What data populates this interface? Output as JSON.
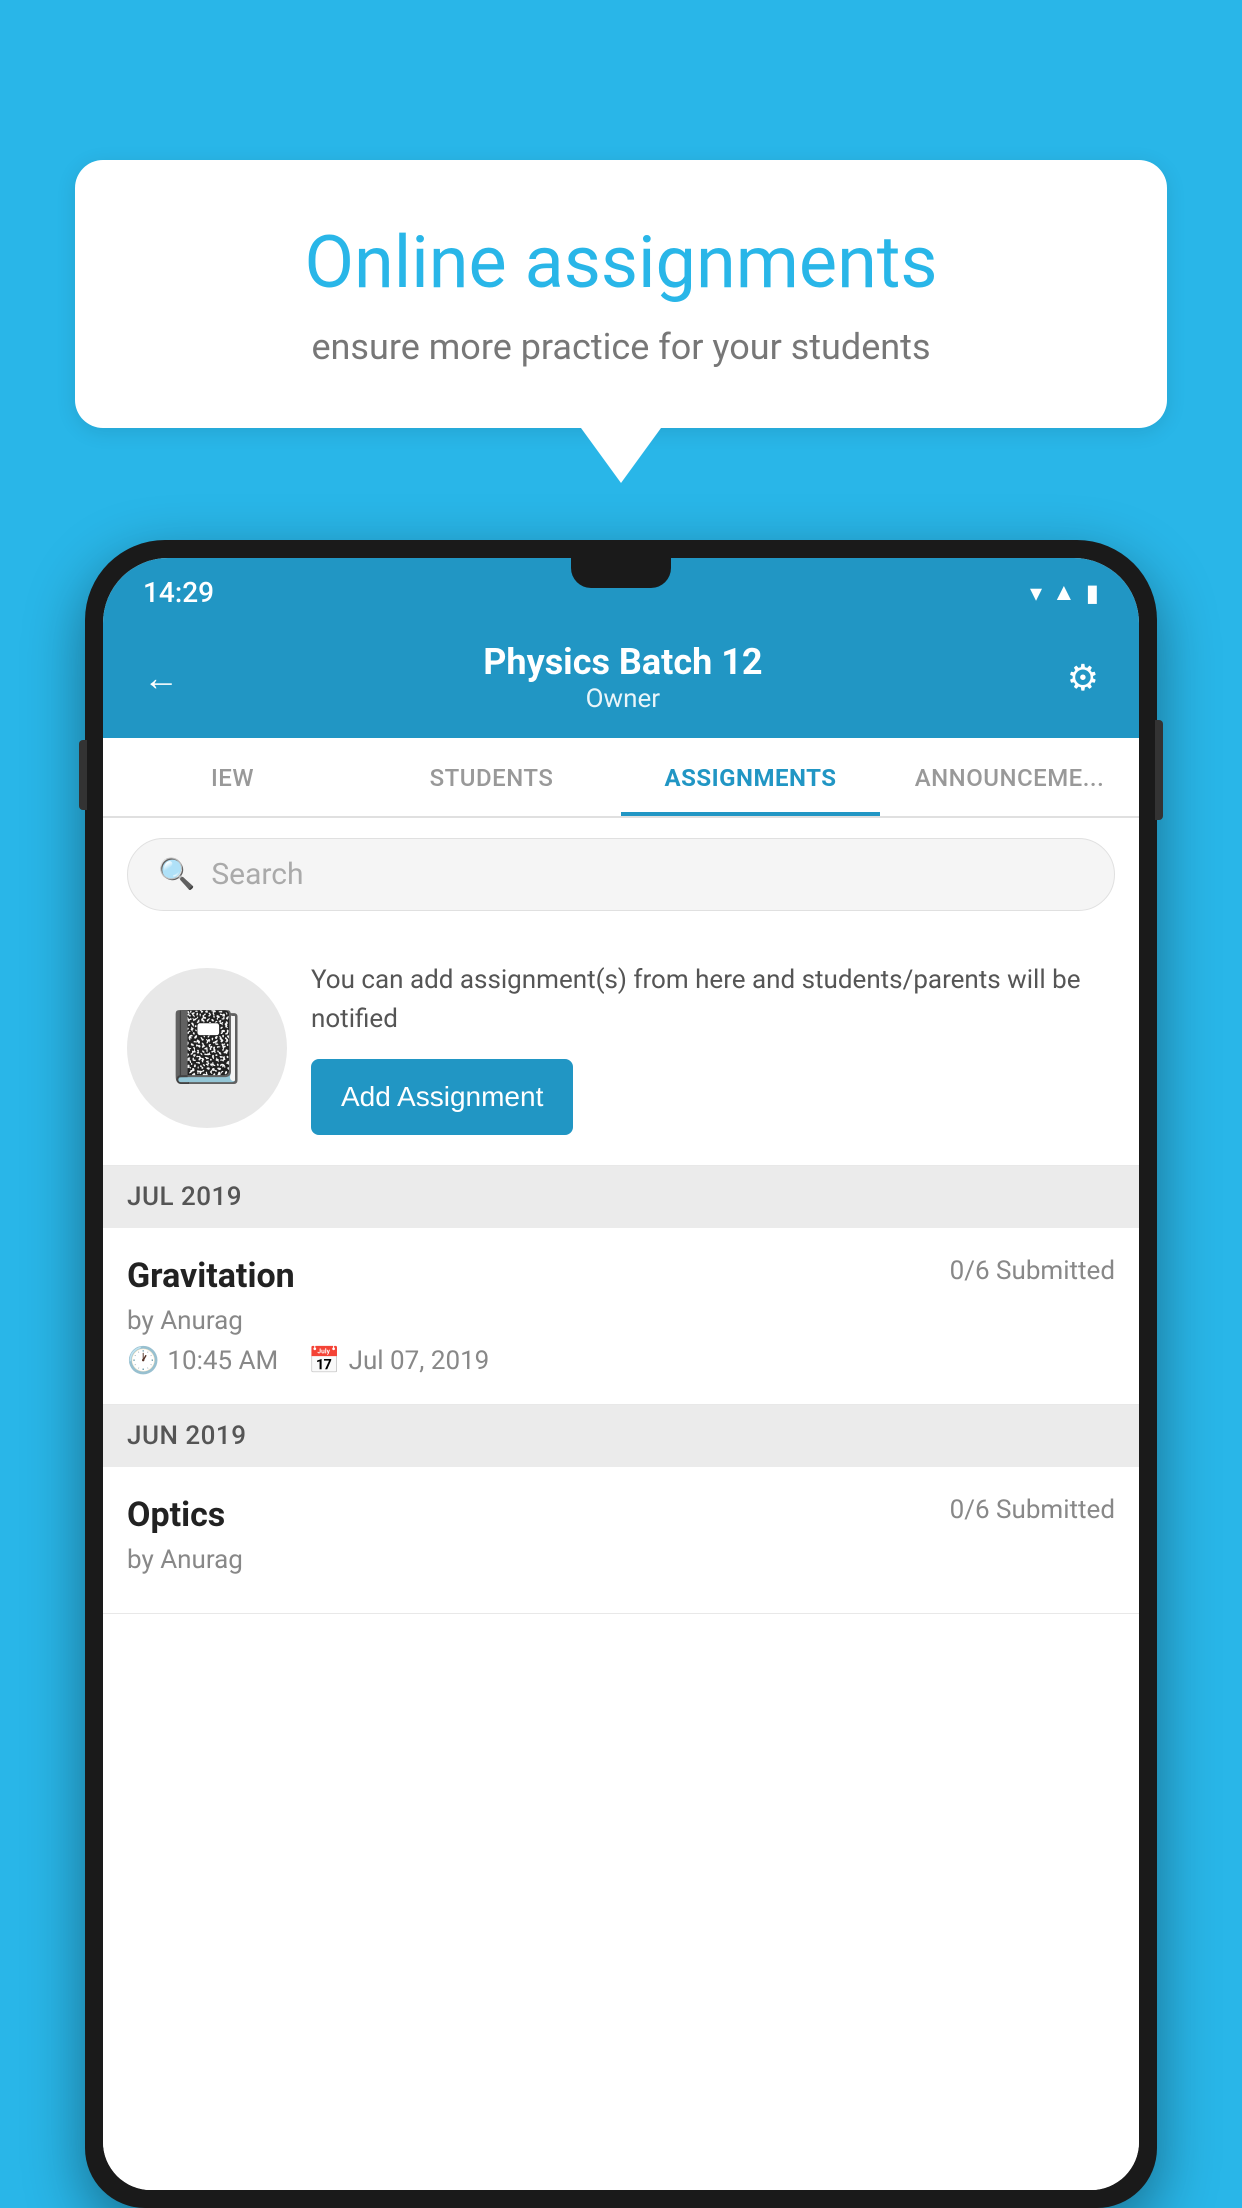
{
  "background_color": "#29b6e8",
  "speech_bubble": {
    "title": "Online assignments",
    "subtitle": "ensure more practice for your students"
  },
  "status_bar": {
    "time": "14:29",
    "wifi": "▼",
    "signal": "▲",
    "battery": "▮"
  },
  "app_header": {
    "title": "Physics Batch 12",
    "subtitle": "Owner",
    "back_label": "←",
    "settings_label": "⚙"
  },
  "tabs": [
    {
      "label": "IEW",
      "active": false
    },
    {
      "label": "STUDENTS",
      "active": false
    },
    {
      "label": "ASSIGNMENTS",
      "active": true
    },
    {
      "label": "ANNOUNCEMENTS",
      "active": false
    }
  ],
  "search": {
    "placeholder": "Search"
  },
  "promo": {
    "description": "You can add assignment(s) from here and students/parents will be notified",
    "button_label": "Add Assignment"
  },
  "sections": [
    {
      "month": "JUL 2019",
      "assignments": [
        {
          "title": "Gravitation",
          "submitted": "0/6 Submitted",
          "by": "by Anurag",
          "time": "10:45 AM",
          "date": "Jul 07, 2019"
        }
      ]
    },
    {
      "month": "JUN 2019",
      "assignments": [
        {
          "title": "Optics",
          "submitted": "0/6 Submitted",
          "by": "by Anurag",
          "time": "",
          "date": ""
        }
      ]
    }
  ]
}
